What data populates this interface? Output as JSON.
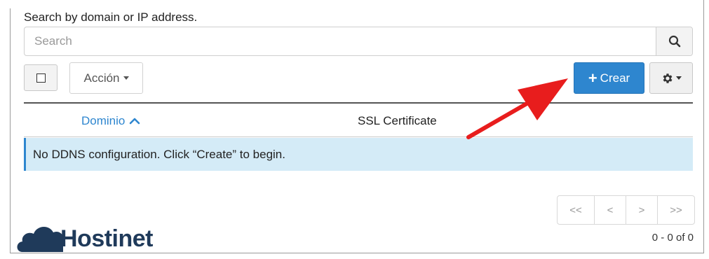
{
  "search": {
    "label": "Search by domain or IP address.",
    "placeholder": "Search"
  },
  "toolbar": {
    "action_label": "Acción",
    "create_label": "Crear"
  },
  "table": {
    "columns": [
      "Dominio",
      "SSL Certificate"
    ],
    "empty_message": "No DDNS configuration. Click “Create” to begin."
  },
  "pagination": {
    "first": "<<",
    "prev": "<",
    "next": ">",
    "last": ">>",
    "count": "0 - 0 of 0"
  },
  "logo": {
    "brand": "Hostinet"
  },
  "colors": {
    "primary": "#2e86cf",
    "row_highlight": "#d4ebf7",
    "arrow": "#e81d1d",
    "logo": "#1f3a5a"
  }
}
